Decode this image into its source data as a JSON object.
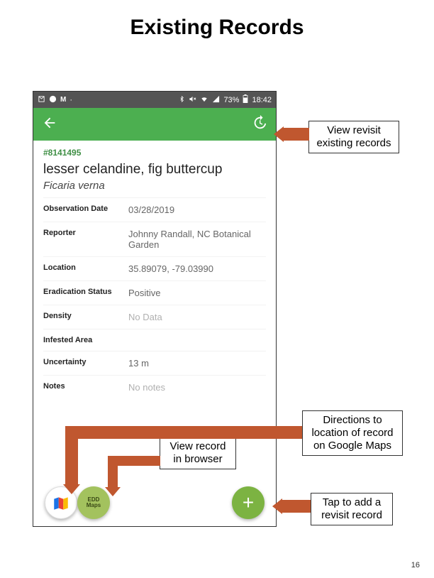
{
  "title": "Existing Records",
  "page_number": "16",
  "status_bar": {
    "battery_pct": "73%",
    "time": "18:42"
  },
  "app_bar": {
    "back_icon": "back-arrow",
    "history_icon": "history"
  },
  "record": {
    "id": "#8141495",
    "common_name": "lesser celandine, fig buttercup",
    "scientific_name": "Ficaria verna",
    "fields": [
      {
        "label": "Observation Date",
        "value": "03/28/2019"
      },
      {
        "label": "Reporter",
        "value": "Johnny Randall, NC Botanical Garden"
      },
      {
        "label": "Location",
        "value": "35.89079, -79.03990"
      },
      {
        "label": "Eradication Status",
        "value": "Positive"
      },
      {
        "label": "Density",
        "value": "No Data",
        "muted": true
      },
      {
        "label": "Infested Area",
        "value": ""
      },
      {
        "label": "Uncertainty",
        "value": "13  m"
      },
      {
        "label": "Notes",
        "value": "No notes",
        "muted": true
      }
    ]
  },
  "fabs": {
    "gmaps": "G",
    "edd": "EDD\nMaps",
    "plus": "+"
  },
  "callouts": {
    "revisit": "View revisit existing records",
    "browser": "View record in browser",
    "directions": "Directions to location of record on Google Maps",
    "add": "Tap to add a revisit record"
  }
}
